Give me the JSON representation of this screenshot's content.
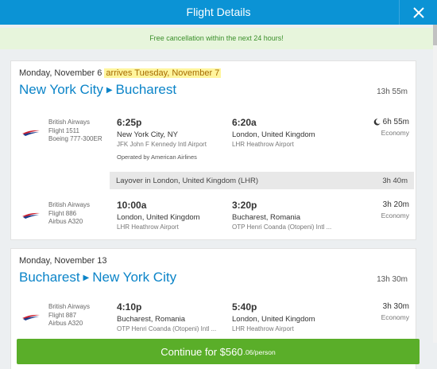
{
  "header": {
    "title": "Flight Details"
  },
  "banner": {
    "text": "Free cancellation within the next 24 hours!"
  },
  "trips": [
    {
      "date": "Monday, November 6",
      "arrives_note": "arrives Tuesday, November 7",
      "origin": "New York City",
      "destination": "Bucharest",
      "duration": "13h 55m",
      "segments": [
        {
          "airline": "British Airways",
          "flight": "Flight 1511",
          "aircraft": "Boeing 777-300ER",
          "dep_time": "6:25p",
          "dep_city": "New York City, NY",
          "dep_airport": "JFK John F Kennedy Intl Airport",
          "arr_time": "6:20a",
          "arr_city": "London, United Kingdom",
          "arr_airport": "LHR Heathrow Airport",
          "operated": "Operated by American Airlines",
          "duration": "6h 55m",
          "class": "Economy"
        },
        {
          "airline": "British Airways",
          "flight": "Flight 886",
          "aircraft": "Airbus A320",
          "dep_time": "10:00a",
          "dep_city": "London, United Kingdom",
          "dep_airport": "LHR Heathrow Airport",
          "arr_time": "3:20p",
          "arr_city": "Bucharest, Romania",
          "arr_airport": "OTP Henri Coanda (Otopeni) Intl ...",
          "duration": "3h 20m",
          "class": "Economy"
        }
      ],
      "layover": {
        "text": "Layover in London, United Kingdom (LHR)",
        "duration": "3h 40m"
      }
    },
    {
      "date": "Monday, November 13",
      "origin": "Bucharest",
      "destination": "New York City",
      "duration": "13h 30m",
      "segments": [
        {
          "airline": "British Airways",
          "flight": "Flight 887",
          "aircraft": "Airbus A320",
          "dep_time": "4:10p",
          "dep_city": "Bucharest, Romania",
          "dep_airport": "OTP Henri Coanda (Otopeni) Intl ...",
          "arr_time": "5:40p",
          "arr_city": "London, United Kingdom",
          "arr_airport": "LHR Heathrow Airport",
          "duration": "3h 30m",
          "class": "Economy"
        }
      ]
    }
  ],
  "cta": {
    "label": "Continue for $560",
    "per_person": ".06/person"
  },
  "colors": {
    "header": "#0b93d5",
    "link": "#0b84c8",
    "cta": "#5aae29",
    "banner_bg": "#e7f5dc",
    "banner_text": "#3a8f2a",
    "highlight": "#fff59d"
  },
  "icons": {
    "close": "close-icon",
    "airline_logo": "british-airways-logo-icon",
    "overnight": "moon-icon",
    "route_arrow": "arrow-right-icon"
  }
}
